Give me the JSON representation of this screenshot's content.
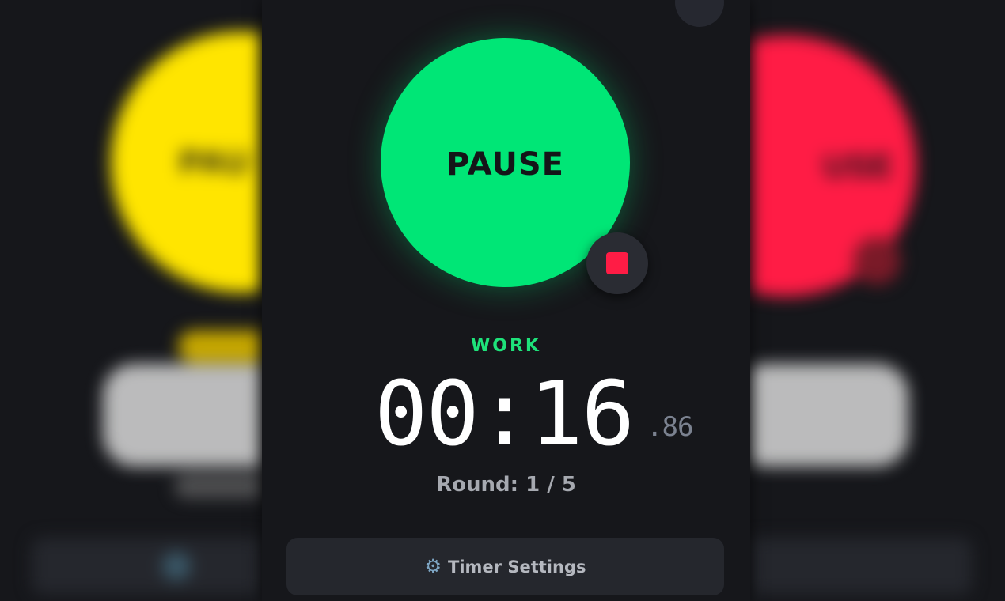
{
  "colors": {
    "work_green": "#00e676",
    "prev_phase_yellow": "#ffe500",
    "next_phase_red": "#ff1c45",
    "background": "#16171b",
    "button_surface": "#25272d"
  },
  "left_preview": {
    "button_label": "PAUSE",
    "button_label_visible": "PAU"
  },
  "right_preview": {
    "button_label": "PAUSE",
    "button_label_visible": "USE"
  },
  "main": {
    "button_label": "PAUSE",
    "stop_icon": "stop-icon",
    "phase": "WORK",
    "time": "00:16",
    "hundredths": ".86",
    "round_text": "Round: 1 / 5"
  },
  "settings": {
    "icon": "gear-icon",
    "gear_glyph": "⚙",
    "label": "Timer Settings"
  }
}
